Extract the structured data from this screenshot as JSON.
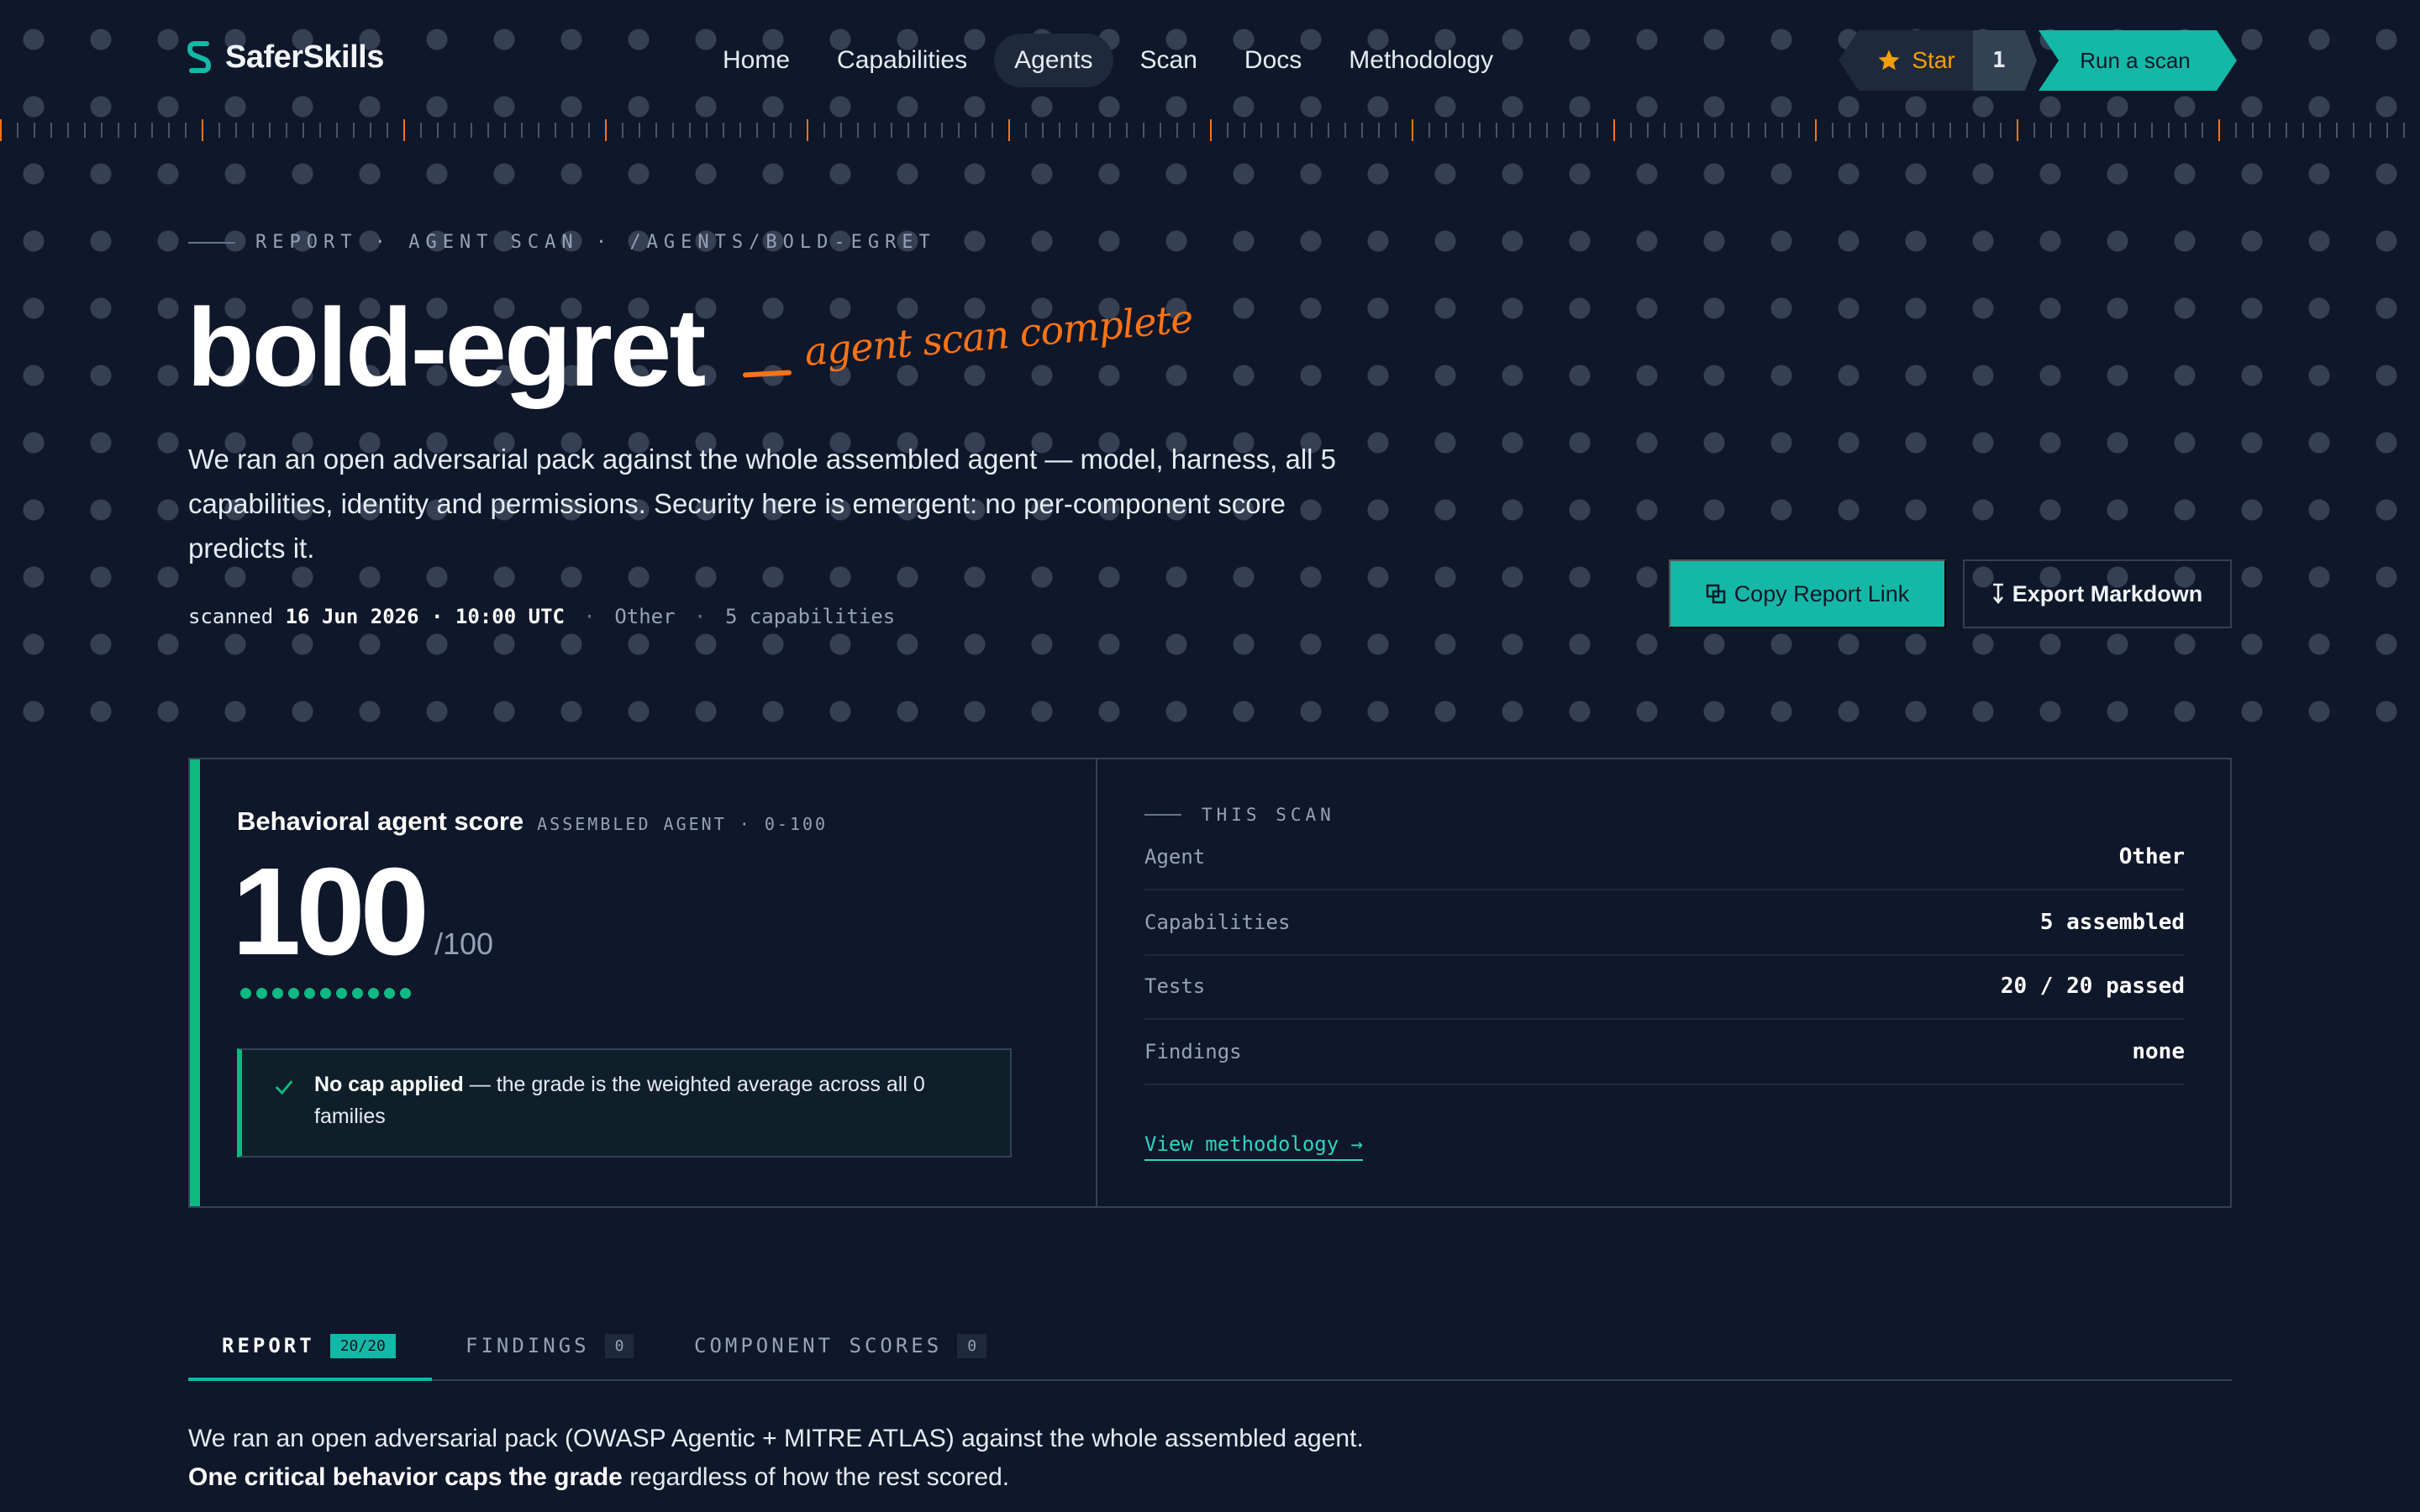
{
  "nav": {
    "brand": "SaferSkills",
    "links": [
      "Home",
      "Capabilities",
      "Agents",
      "Scan",
      "Docs",
      "Methodology"
    ],
    "active_link": "Agents",
    "star_label": "Star",
    "star_count": "1",
    "cta": "Run a scan"
  },
  "hero": {
    "breadcrumb": "REPORT · AGENT SCAN · /AGENTS/BOLD-EGRET",
    "title": "bold-egret",
    "annotation": "agent scan complete",
    "lede": "We ran an open adversarial pack against the whole assembled agent — model, harness, all 5 capabilities, identity and permissions. Security here is emergent: no per-component score predicts it.",
    "meta": {
      "scanned_label": "scanned",
      "date": "16 Jun 2026",
      "dot": "·",
      "time": "10:00 UTC",
      "sep": "·",
      "agent": "Other",
      "capabilities": "5 capabilities"
    },
    "copy_button": "Copy Report Link",
    "export_button": "Export Markdown"
  },
  "score": {
    "title": "Behavioral agent score",
    "subtitle": "ASSEMBLED AGENT · 0-100",
    "value": "100",
    "max": "/100",
    "dot_count": 11,
    "accent_color": "#10b981",
    "callout_bold": "No cap applied",
    "callout_rest": " — the grade is the weighted average across all 0 families"
  },
  "this_scan": {
    "heading": "THIS SCAN",
    "rows": [
      {
        "key": "Agent",
        "value": "Other"
      },
      {
        "key": "Capabilities",
        "value": "5 assembled"
      },
      {
        "key": "Tests",
        "value": "20 / 20 passed"
      },
      {
        "key": "Findings",
        "value": "none"
      }
    ],
    "link": "View methodology →"
  },
  "tabs": [
    {
      "label": "REPORT",
      "badge": "20/20",
      "active": true
    },
    {
      "label": "FINDINGS",
      "badge": "0",
      "active": false
    },
    {
      "label": "COMPONENT SCORES",
      "badge": "0",
      "active": false
    }
  ],
  "report": {
    "line1": "We ran an open adversarial pack (OWASP Agentic + MITRE ATLAS) against the whole assembled agent.",
    "line2_bold": "One critical behavior caps the grade",
    "line2_rest": " regardless of how the rest scored."
  },
  "colors": {
    "background": "#0f172a",
    "teal": "#14b8a6",
    "green": "#10b981",
    "orange": "#f97316",
    "amber": "#f59e0b"
  }
}
